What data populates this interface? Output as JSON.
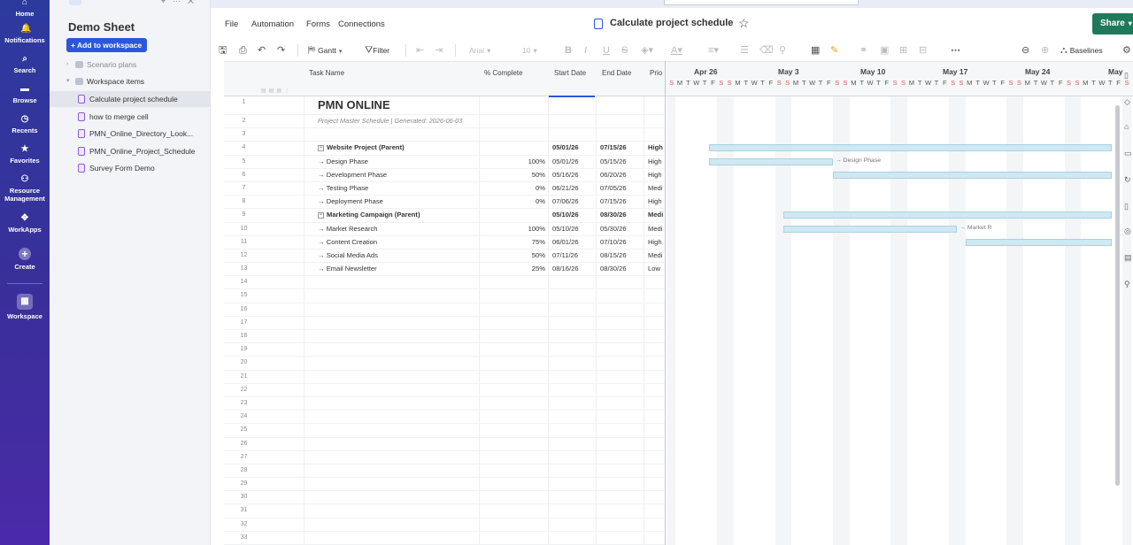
{
  "rail": {
    "items": [
      {
        "label": "Home",
        "icon": "home-icon",
        "glyph": "⌂"
      },
      {
        "label": "Notifications",
        "icon": "bell-icon",
        "glyph": "🔔"
      },
      {
        "label": "Search",
        "icon": "search-icon",
        "glyph": "⌕"
      },
      {
        "label": "Browse",
        "icon": "folder-icon",
        "glyph": "▬"
      },
      {
        "label": "Recents",
        "icon": "clock-icon",
        "glyph": "◷"
      },
      {
        "label": "Favorites",
        "icon": "star-icon",
        "glyph": "★"
      },
      {
        "label": "Resource Management",
        "icon": "people-icon",
        "glyph": "⚇"
      },
      {
        "label": "WorkApps",
        "icon": "workapps-icon",
        "glyph": "✥"
      },
      {
        "label": "Create",
        "icon": "plus-icon",
        "glyph": "+"
      },
      {
        "label": "Workspace",
        "icon": "workspace-icon",
        "glyph": "▦"
      }
    ]
  },
  "sidebar": {
    "title": "Demo Sheet",
    "add_button": "+ Add to workspace",
    "groups": [
      {
        "label": "Scenario plans",
        "expanded": false
      },
      {
        "label": "Workspace items",
        "expanded": true
      }
    ],
    "items": [
      {
        "label": "Calculate project schedule",
        "active": true
      },
      {
        "label": "how to merge cell",
        "active": false
      },
      {
        "label": "PMN_Online_Directory_Look...",
        "active": false
      },
      {
        "label": "PMN_Online_Project_Schedule",
        "active": false
      },
      {
        "label": "Survey Form Demo",
        "active": false
      }
    ]
  },
  "menu": {
    "file": "File",
    "automation": "Automation",
    "forms": "Forms",
    "connections": "Connections",
    "doc_title": "Calculate project schedule",
    "share": "Share"
  },
  "toolbar": {
    "view": "Gantt",
    "filter": "Filter",
    "font": "Arial",
    "font_size": "10",
    "baselines": "Baselines"
  },
  "grid": {
    "headers": {
      "task": "Task Name",
      "pct": "% Complete",
      "start": "Start Date",
      "end": "End Date",
      "priority": "Prio"
    },
    "rows": [
      {
        "n": "1",
        "task": "PMN ONLINE",
        "pct": "",
        "start": "",
        "end": "",
        "pri": "",
        "kind": "title"
      },
      {
        "n": "2",
        "task": "Project Master Schedule | Generated: 2026-06-03",
        "pct": "",
        "start": "",
        "end": "",
        "pri": "",
        "kind": "sub"
      },
      {
        "n": "3",
        "task": "",
        "pct": "",
        "start": "",
        "end": "",
        "pri": "",
        "kind": "empty"
      },
      {
        "n": "4",
        "task": "Website Project (Parent)",
        "pct": "",
        "start": "05/01/26",
        "end": "07/15/26",
        "pri": "High",
        "kind": "parent"
      },
      {
        "n": "5",
        "task": "→ Design Phase",
        "pct": "100%",
        "start": "05/01/26",
        "end": "05/15/26",
        "pri": "High",
        "kind": "child"
      },
      {
        "n": "6",
        "task": "→ Development Phase",
        "pct": "50%",
        "start": "05/16/26",
        "end": "06/20/26",
        "pri": "High",
        "kind": "child"
      },
      {
        "n": "7",
        "task": "→ Testing Phase",
        "pct": "0%",
        "start": "06/21/26",
        "end": "07/05/26",
        "pri": "Medi",
        "kind": "child"
      },
      {
        "n": "8",
        "task": "→ Deployment Phase",
        "pct": "0%",
        "start": "07/06/26",
        "end": "07/15/26",
        "pri": "High",
        "kind": "child"
      },
      {
        "n": "9",
        "task": "Marketing Campaign (Parent)",
        "pct": "",
        "start": "05/10/26",
        "end": "08/30/26",
        "pri": "Medi",
        "kind": "parent"
      },
      {
        "n": "10",
        "task": "→ Market Research",
        "pct": "100%",
        "start": "05/10/26",
        "end": "05/30/26",
        "pri": "Medi",
        "kind": "child"
      },
      {
        "n": "11",
        "task": "→ Content Creation",
        "pct": "75%",
        "start": "06/01/26",
        "end": "07/10/26",
        "pri": "High",
        "kind": "child"
      },
      {
        "n": "12",
        "task": "→ Social Media Ads",
        "pct": "50%",
        "start": "07/11/26",
        "end": "08/15/26",
        "pri": "Medi",
        "kind": "child"
      },
      {
        "n": "13",
        "task": "→ Email Newsletter",
        "pct": "25%",
        "start": "08/16/26",
        "end": "08/30/26",
        "pri": "Low",
        "kind": "child"
      },
      {
        "n": "14",
        "kind": "empty"
      },
      {
        "n": "15",
        "kind": "empty"
      },
      {
        "n": "16",
        "kind": "empty"
      },
      {
        "n": "17",
        "kind": "empty"
      },
      {
        "n": "18",
        "kind": "empty"
      },
      {
        "n": "19",
        "kind": "empty"
      },
      {
        "n": "20",
        "kind": "empty"
      },
      {
        "n": "21",
        "kind": "empty"
      },
      {
        "n": "22",
        "kind": "empty"
      },
      {
        "n": "23",
        "kind": "empty"
      },
      {
        "n": "24",
        "kind": "empty"
      },
      {
        "n": "25",
        "kind": "empty"
      },
      {
        "n": "26",
        "kind": "empty"
      },
      {
        "n": "27",
        "kind": "empty"
      },
      {
        "n": "28",
        "kind": "empty"
      },
      {
        "n": "29",
        "kind": "empty"
      },
      {
        "n": "30",
        "kind": "empty"
      },
      {
        "n": "31",
        "kind": "empty"
      },
      {
        "n": "32",
        "kind": "empty"
      },
      {
        "n": "33",
        "kind": "empty"
      }
    ]
  },
  "gantt": {
    "weeks": [
      "Apr 26",
      "May 3",
      "May 10",
      "May 17",
      "May 24",
      "May"
    ],
    "day_letters": [
      "S",
      "M",
      "T",
      "W",
      "T",
      "F",
      "S"
    ],
    "bars": [
      {
        "row": 4,
        "start": "05/01/26",
        "end": "07/15/26",
        "label": ""
      },
      {
        "row": 5,
        "start": "05/01/26",
        "end": "05/15/26",
        "label": "→ Design Phase"
      },
      {
        "row": 6,
        "start": "05/16/26",
        "end": "06/20/26",
        "label": ""
      },
      {
        "row": 9,
        "start": "05/10/26",
        "end": "08/30/26",
        "label": ""
      },
      {
        "row": 10,
        "start": "05/10/26",
        "end": "05/30/26",
        "label": "→ Market R"
      },
      {
        "row": 11,
        "start": "06/01/26",
        "end": "07/10/26",
        "label": ""
      }
    ]
  }
}
